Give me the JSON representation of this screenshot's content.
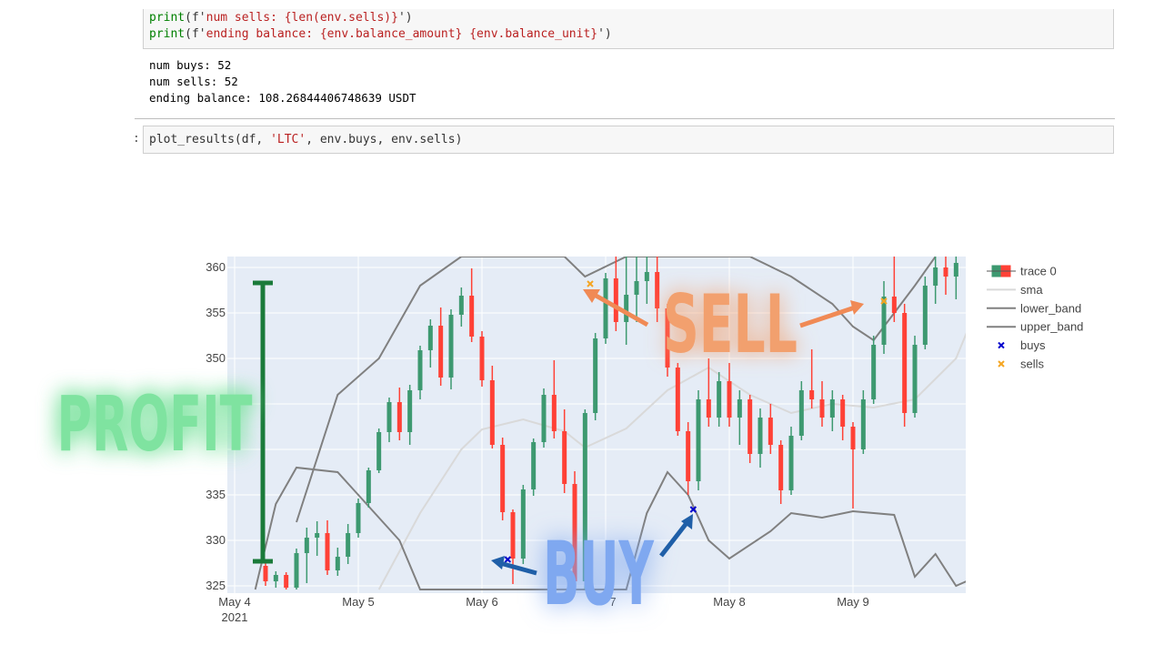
{
  "notebook": {
    "cell1_lines": [
      {
        "fn": "print",
        "open": "(f'",
        "text": "num sells: {len(env.sells)}",
        "close": "')"
      },
      {
        "fn": "print",
        "open": "(f'",
        "text": "ending balance: {env.balance_amount} {env.balance_unit}",
        "close": "')"
      }
    ],
    "output_lines": [
      "num buys: 52",
      "num sells: 52",
      "ending balance: 108.26844406748639 USDT"
    ],
    "cell2_prompt": ":",
    "cell2_code": {
      "prefix": "plot_results(df, ",
      "str": "'LTC'",
      "suffix": ", env.buys, env.sells)"
    }
  },
  "overlay": {
    "profit_label": "PROFIT",
    "sell_label": "SELL",
    "buy_label": "BUY",
    "colors": {
      "profit": "#7fe3a0",
      "profit_bar": "#1a7a3a",
      "sell": "#f2a06e",
      "sell_arrow": "#f08a55",
      "buy": "#7fa8f0",
      "buy_arrow": "#1f5fa8"
    }
  },
  "chart_data": {
    "type": "candlestick",
    "xlabel": "",
    "ylabel": "",
    "ylim": [
      324.5,
      361.2
    ],
    "x_ticks": [
      {
        "date": "2021-05-04",
        "label": "May 4",
        "sublabel": "2021"
      },
      {
        "date": "2021-05-05",
        "label": "May 5"
      },
      {
        "date": "2021-05-06",
        "label": "May 6"
      },
      {
        "date": "2021-05-07",
        "label": "7"
      },
      {
        "date": "2021-05-08",
        "label": "May 8"
      },
      {
        "date": "2021-05-09",
        "label": "May 9"
      }
    ],
    "y_ticks": [
      325,
      330,
      335,
      340,
      345,
      350,
      355,
      360
    ],
    "y_tick_labels": [
      "325",
      "330",
      "335",
      "",
      "",
      "350",
      "355",
      "360"
    ],
    "x_range": [
      "2021-05-04 00:00",
      "2021-05-10 00:00"
    ],
    "legend": {
      "placement": "top-right",
      "entries": [
        {
          "name": "trace 0",
          "kind": "candle"
        },
        {
          "name": "sma",
          "kind": "line",
          "color": "#d9d9d9"
        },
        {
          "name": "lower_band",
          "kind": "line",
          "color": "#808080"
        },
        {
          "name": "upper_band",
          "kind": "line",
          "color": "#808080"
        },
        {
          "name": "buys",
          "kind": "marker",
          "color": "#0000cc"
        },
        {
          "name": "sells",
          "kind": "marker",
          "color": "#f5a623"
        }
      ]
    },
    "colors": {
      "bg": "#e5ecf6",
      "grid": "#ffffff",
      "inc": "#3d9970",
      "dec": "#ff4136",
      "sma": "#d9d9d9",
      "band": "#808080",
      "buy": "#0000cc",
      "sell": "#f5a623"
    },
    "buys": [
      {
        "t": "2021-05-06 05:00",
        "price": 327.9
      },
      {
        "t": "2021-05-07 17:00",
        "price": 333.4
      }
    ],
    "sells": [
      {
        "t": "2021-05-06 21:00",
        "price": 358.2
      },
      {
        "t": "2021-05-09 06:00",
        "price": 356.3
      }
    ],
    "sma": [
      [
        "2021-05-05 04:00",
        324.6
      ],
      [
        "2021-05-05 12:00",
        333
      ],
      [
        "2021-05-05 20:00",
        340
      ],
      [
        "2021-05-06 00:00",
        342.2
      ],
      [
        "2021-05-06 08:00",
        343.3
      ],
      [
        "2021-05-06 16:00",
        342
      ],
      [
        "2021-05-06 20:00",
        340.2
      ],
      [
        "2021-05-07 04:00",
        342.3
      ],
      [
        "2021-05-07 12:00",
        346.5
      ],
      [
        "2021-05-07 20:00",
        349
      ],
      [
        "2021-05-08 04:00",
        346
      ],
      [
        "2021-05-08 12:00",
        344
      ],
      [
        "2021-05-08 20:00",
        345
      ],
      [
        "2021-05-09 04:00",
        344.6
      ],
      [
        "2021-05-09 12:00",
        345.5
      ],
      [
        "2021-05-09 20:00",
        350
      ],
      [
        "2021-05-10 00:00",
        355.5
      ]
    ],
    "lower_band": [
      [
        "2021-05-04 04:00",
        324.6
      ],
      [
        "2021-05-04 08:00",
        334
      ],
      [
        "2021-05-04 12:00",
        338
      ],
      [
        "2021-05-04 20:00",
        337.5
      ],
      [
        "2021-05-05 00:00",
        335
      ],
      [
        "2021-05-05 08:00",
        330
      ],
      [
        "2021-05-05 12:00",
        324.6
      ],
      [
        "2021-05-07 04:00",
        324.6
      ],
      [
        "2021-05-07 08:00",
        333
      ],
      [
        "2021-05-07 12:00",
        337.5
      ],
      [
        "2021-05-07 16:00",
        335
      ],
      [
        "2021-05-07 20:00",
        330
      ],
      [
        "2021-05-08 00:00",
        328
      ],
      [
        "2021-05-08 08:00",
        331
      ],
      [
        "2021-05-08 12:00",
        333
      ],
      [
        "2021-05-08 18:00",
        332.5
      ],
      [
        "2021-05-09 00:00",
        333.2
      ],
      [
        "2021-05-09 08:00",
        332.8
      ],
      [
        "2021-05-09 12:00",
        326
      ],
      [
        "2021-05-09 16:00",
        328.5
      ],
      [
        "2021-05-09 20:00",
        325
      ],
      [
        "2021-05-10 00:00",
        326
      ]
    ],
    "upper_band": [
      [
        "2021-05-04 12:00",
        332
      ],
      [
        "2021-05-04 20:00",
        346
      ],
      [
        "2021-05-05 04:00",
        350
      ],
      [
        "2021-05-05 12:00",
        358
      ],
      [
        "2021-05-05 20:00",
        361.2
      ],
      [
        "2021-05-06 16:00",
        361.2
      ],
      [
        "2021-05-06 20:00",
        359
      ],
      [
        "2021-05-07 04:00",
        361.2
      ],
      [
        "2021-05-07 20:00",
        361.2
      ],
      [
        "2021-05-08 04:00",
        361.2
      ],
      [
        "2021-05-08 12:00",
        359
      ],
      [
        "2021-05-08 20:00",
        356
      ],
      [
        "2021-05-09 00:00",
        353.5
      ],
      [
        "2021-05-09 04:00",
        352
      ],
      [
        "2021-05-09 12:00",
        358
      ],
      [
        "2021-05-09 16:00",
        361.2
      ]
    ],
    "candles": [
      [
        "2021-05-04 06:00",
        327.2,
        327.5,
        325.0,
        325.5
      ],
      [
        "2021-05-04 08:00",
        325.5,
        326.6,
        324.8,
        326.2
      ],
      [
        "2021-05-04 10:00",
        326.2,
        326.5,
        324.6,
        324.8
      ],
      [
        "2021-05-04 12:00",
        324.8,
        329.1,
        324.6,
        328.6
      ],
      [
        "2021-05-04 14:00",
        328.6,
        331.4,
        325.3,
        330.3
      ],
      [
        "2021-05-04 16:00",
        330.3,
        332.1,
        328.3,
        330.8
      ],
      [
        "2021-05-04 18:00",
        330.8,
        332.2,
        326.2,
        326.7
      ],
      [
        "2021-05-04 20:00",
        326.7,
        329.2,
        326.1,
        328.2
      ],
      [
        "2021-05-04 22:00",
        328.2,
        331.8,
        327.4,
        330.8
      ],
      [
        "2021-05-05 00:00",
        330.8,
        334.6,
        330.3,
        334.1
      ],
      [
        "2021-05-05 02:00",
        334.1,
        338.0,
        333.6,
        337.7
      ],
      [
        "2021-05-05 04:00",
        337.7,
        342.3,
        337.4,
        341.9
      ],
      [
        "2021-05-05 06:00",
        341.9,
        345.7,
        340.8,
        345.2
      ],
      [
        "2021-05-05 08:00",
        345.2,
        346.8,
        341.0,
        341.9
      ],
      [
        "2021-05-05 10:00",
        341.9,
        347.1,
        340.5,
        346.5
      ],
      [
        "2021-05-05 12:00",
        346.5,
        351.4,
        345.5,
        350.9
      ],
      [
        "2021-05-05 14:00",
        350.9,
        354.3,
        349.0,
        353.6
      ],
      [
        "2021-05-05 16:00",
        353.6,
        355.6,
        347.0,
        347.9
      ],
      [
        "2021-05-05 18:00",
        347.9,
        355.4,
        346.6,
        354.8
      ],
      [
        "2021-05-05 20:00",
        354.8,
        357.8,
        353.5,
        356.9
      ],
      [
        "2021-05-05 22:00",
        356.9,
        359.9,
        351.8,
        352.4
      ],
      [
        "2021-05-06 00:00",
        352.4,
        353.0,
        346.9,
        347.6
      ],
      [
        "2021-05-06 02:00",
        347.6,
        349.2,
        340.1,
        340.5
      ],
      [
        "2021-05-06 04:00",
        340.5,
        341.3,
        332.2,
        333.1
      ],
      [
        "2021-05-06 06:00",
        333.1,
        333.4,
        325.2,
        328.0
      ],
      [
        "2021-05-06 08:00",
        328.0,
        336.1,
        327.4,
        335.6
      ],
      [
        "2021-05-06 10:00",
        335.6,
        341.2,
        334.9,
        340.8
      ],
      [
        "2021-05-06 12:00",
        340.8,
        346.7,
        340.2,
        346.0
      ],
      [
        "2021-05-06 14:00",
        346.0,
        349.8,
        341.2,
        342.0
      ],
      [
        "2021-05-06 16:00",
        342.0,
        344.4,
        335.2,
        336.2
      ],
      [
        "2021-05-06 18:00",
        336.2,
        337.6,
        324.8,
        325.5
      ],
      [
        "2021-05-06 20:00",
        325.5,
        344.4,
        324.6,
        344.0
      ],
      [
        "2021-05-06 22:00",
        344.0,
        352.8,
        343.2,
        352.2
      ],
      [
        "2021-05-07 00:00",
        352.2,
        359.4,
        351.6,
        358.8
      ],
      [
        "2021-05-07 02:00",
        358.8,
        361.2,
        353.0,
        354.0
      ],
      [
        "2021-05-07 04:00",
        354.0,
        361.2,
        351.5,
        357.0
      ],
      [
        "2021-05-07 06:00",
        357.0,
        361.2,
        354.0,
        358.5
      ],
      [
        "2021-05-07 08:00",
        358.5,
        361.2,
        356.0,
        359.5
      ],
      [
        "2021-05-07 10:00",
        359.5,
        361.2,
        354.0,
        355.5
      ],
      [
        "2021-05-07 12:00",
        355.5,
        356.0,
        348.0,
        349.0
      ],
      [
        "2021-05-07 14:00",
        349.0,
        349.5,
        341.5,
        342.0
      ],
      [
        "2021-05-07 16:00",
        342.0,
        343.0,
        335.0,
        336.5
      ],
      [
        "2021-05-07 18:00",
        336.5,
        346.5,
        335.5,
        345.5
      ],
      [
        "2021-05-07 20:00",
        345.5,
        350.0,
        342.5,
        343.5
      ],
      [
        "2021-05-07 22:00",
        343.5,
        348.5,
        342.5,
        347.5
      ],
      [
        "2021-05-08 00:00",
        347.5,
        349.5,
        342.5,
        343.5
      ],
      [
        "2021-05-08 02:00",
        343.5,
        346.5,
        340.5,
        345.5
      ],
      [
        "2021-05-08 04:00",
        345.5,
        346.0,
        338.5,
        339.5
      ],
      [
        "2021-05-08 06:00",
        339.5,
        344.5,
        338.0,
        343.5
      ],
      [
        "2021-05-08 08:00",
        343.5,
        345.0,
        339.5,
        340.5
      ],
      [
        "2021-05-08 10:00",
        340.5,
        341.0,
        334.0,
        335.5
      ],
      [
        "2021-05-08 12:00",
        335.5,
        342.5,
        335.0,
        341.5
      ],
      [
        "2021-05-08 14:00",
        341.5,
        347.5,
        341.0,
        346.5
      ],
      [
        "2021-05-08 16:00",
        346.5,
        351.0,
        344.5,
        345.5
      ],
      [
        "2021-05-08 18:00",
        345.5,
        347.5,
        342.5,
        343.5
      ],
      [
        "2021-05-08 20:00",
        343.5,
        346.5,
        342.0,
        345.5
      ],
      [
        "2021-05-08 22:00",
        345.5,
        346.0,
        341.0,
        342.5
      ],
      [
        "2021-05-09 00:00",
        342.5,
        343.0,
        333.5,
        340.0
      ],
      [
        "2021-05-09 02:00",
        340.0,
        346.5,
        339.5,
        345.5
      ],
      [
        "2021-05-09 04:00",
        345.5,
        352.5,
        345.0,
        351.5
      ],
      [
        "2021-05-09 06:00",
        351.5,
        358.5,
        350.5,
        356.8
      ],
      [
        "2021-05-09 08:00",
        356.8,
        361.2,
        354.0,
        355.0
      ],
      [
        "2021-05-09 10:00",
        355.0,
        356.0,
        342.5,
        344.0
      ],
      [
        "2021-05-09 12:00",
        344.0,
        352.5,
        343.5,
        351.5
      ],
      [
        "2021-05-09 14:00",
        351.5,
        359.0,
        351.0,
        358.0
      ],
      [
        "2021-05-09 16:00",
        358.0,
        361.2,
        356.0,
        360.0
      ],
      [
        "2021-05-09 18:00",
        360.0,
        361.2,
        357.0,
        359.0
      ],
      [
        "2021-05-09 20:00",
        359.0,
        361.2,
        356.5,
        360.5
      ]
    ]
  }
}
